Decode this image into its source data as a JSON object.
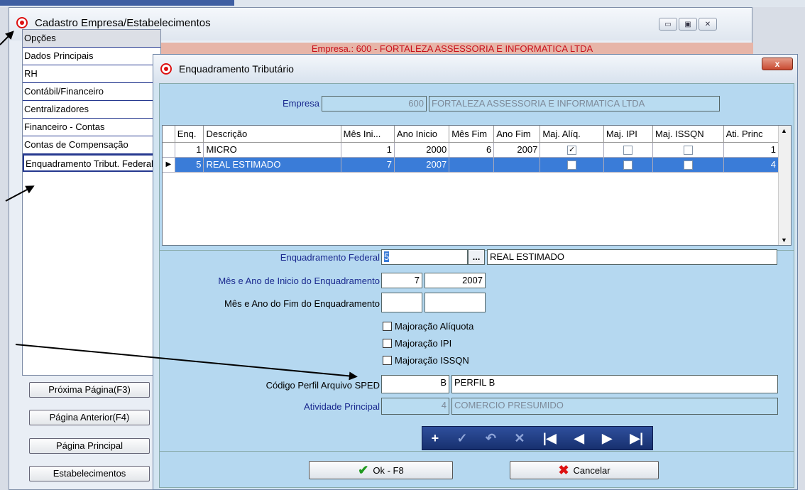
{
  "outer_window": {
    "title": "Cadastro Empresa/Estabelecimentos",
    "empresa_bar": "Empresa.: 600 - FORTALEZA ASSESSORIA E INFORMATICA LTDA",
    "win_buttons": [
      "▭",
      "▣",
      "✕"
    ]
  },
  "left_menu": {
    "items": [
      "Opções",
      "Dados Principais",
      "RH",
      "Contábil/Financeiro",
      "Centralizadores",
      "Financeiro - Contas",
      "Contas de Compensação",
      "Enquadramento Tribut. Federal"
    ],
    "buttons": [
      "Próxima Página(F3)",
      "Página Anterior(F4)",
      "Página Principal",
      "Estabelecimentos"
    ]
  },
  "dialog": {
    "title": "Enquadramento Tributário",
    "close_label": "x",
    "empresa_label": "Empresa",
    "empresa_code": "600",
    "empresa_name": "FORTALEZA ASSESSORIA E INFORMATICA LTDA",
    "grid": {
      "columns": [
        "Enq.",
        "Descrição",
        "Mês Ini...",
        "Ano Inicio",
        "Mês Fim",
        "Ano Fim",
        "Maj. Alíq.",
        "Maj. IPI",
        "Maj. ISSQN",
        "Ati. Princ"
      ],
      "rows": [
        {
          "enq": "1",
          "descricao": "MICRO",
          "mes_ini": "1",
          "ano_ini": "2000",
          "mes_fim": "6",
          "ano_fim": "2007",
          "maj_aliq": true,
          "maj_ipi": false,
          "maj_issqn": false,
          "ati_princ": "1"
        },
        {
          "enq": "5",
          "descricao": "REAL ESTIMADO",
          "mes_ini": "7",
          "ano_ini": "2007",
          "mes_fim": "",
          "ano_fim": "",
          "maj_aliq": false,
          "maj_ipi": false,
          "maj_issqn": false,
          "ati_princ": "4"
        }
      ]
    },
    "form": {
      "enq_federal_label": "Enquadramento Federal",
      "enq_federal_code": "5",
      "enq_federal_btn": "...",
      "enq_federal_desc": "REAL ESTIMADO",
      "inicio_label": "Mês e Ano de Inicio do Enquadramento",
      "inicio_mes": "7",
      "inicio_ano": "2007",
      "fim_label": "Mês e Ano do Fim do Enquadramento",
      "fim_mes": "",
      "fim_ano": "",
      "maj_aliquota": "Majoração Alíquota",
      "maj_ipi": "Majoração IPI",
      "maj_issqn": "Majoração ISSQN",
      "sped_label": "Código Perfil Arquivo SPED",
      "sped_code": "B",
      "sped_desc": "PERFIL B",
      "ativ_label": "Atividade Principal",
      "ativ_code": "4",
      "ativ_desc": "COMERCIO PRESUMIDO"
    },
    "nav_icons": [
      "plus-icon",
      "check-icon",
      "undo-icon",
      "delete-icon",
      "first-icon",
      "prior-icon",
      "next-icon",
      "last-icon"
    ],
    "ok_label": "Ok - F8",
    "cancel_label": "Cancelar"
  }
}
